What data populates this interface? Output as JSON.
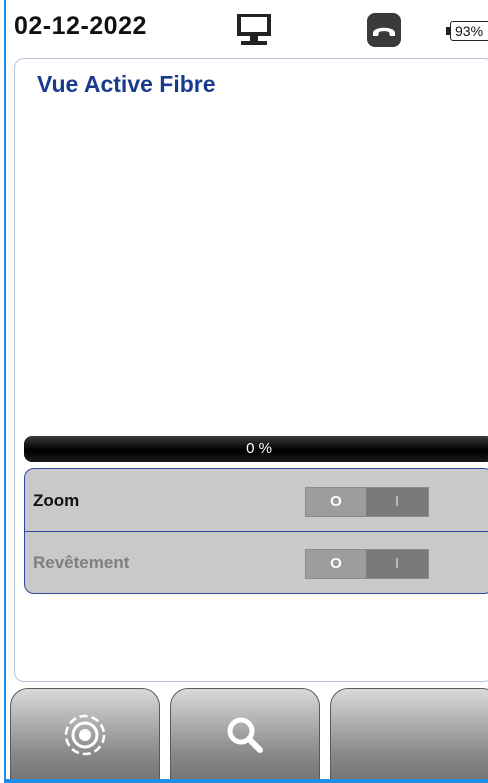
{
  "status": {
    "date": "02-12-2022",
    "battery": "93%",
    "icons": [
      "computer-icon",
      "phone-hangup-icon",
      "battery-icon"
    ]
  },
  "panel": {
    "title": "Vue Active Fibre",
    "progress": {
      "label": "0 %",
      "value": 0
    },
    "options": [
      {
        "label": "Zoom",
        "enabled": true,
        "toggle_off": "O",
        "toggle_on": "I",
        "state": "off"
      },
      {
        "label": "Revêtement",
        "enabled": false,
        "toggle_off": "O",
        "toggle_on": "I",
        "state": "off"
      }
    ]
  },
  "softkeys": [
    {
      "icon": "capture-icon"
    },
    {
      "icon": "search-icon"
    },
    {
      "icon": ""
    }
  ],
  "colors": {
    "frame": "#1f8ee8",
    "title": "#1a3a8e",
    "option_border": "#2d4d9a",
    "option_bg": "#c9c9c9"
  }
}
